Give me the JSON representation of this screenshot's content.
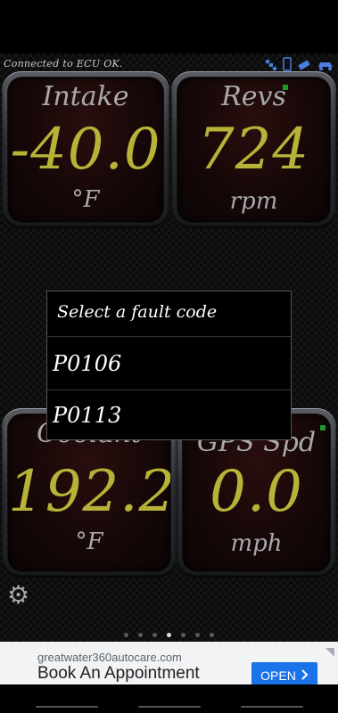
{
  "status": {
    "connection_text": "Connected to ECU OK."
  },
  "gauges": [
    {
      "label": "Intake",
      "value": "-40.0",
      "unit": "°F"
    },
    {
      "label": "Revs",
      "value": "724",
      "unit": "rpm"
    },
    {
      "label": "Coolant",
      "value": "192.2",
      "unit": "°F"
    },
    {
      "label": "GPS Spd",
      "value": "0.0",
      "unit": "mph"
    }
  ],
  "dialog": {
    "title": "Select a fault code",
    "items": [
      "P0106",
      "P0113"
    ]
  },
  "pager": {
    "total": 7,
    "active_index": 3
  },
  "ad": {
    "url": "greatwater360autocare.com",
    "title": "Book An Appointment",
    "button_label": "OPEN"
  },
  "colors": {
    "gauge_value": "#b7b338",
    "led": "#1b9a2a",
    "ad_button": "#1a73e8"
  }
}
